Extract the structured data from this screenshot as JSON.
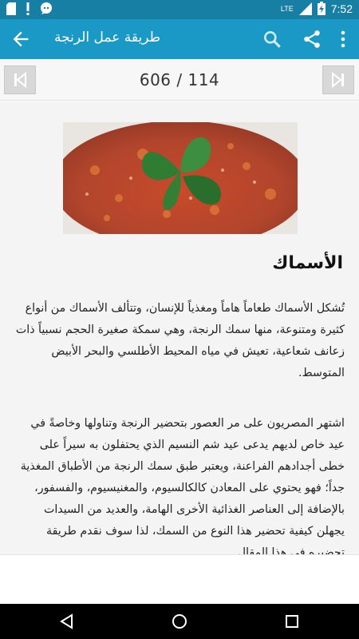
{
  "status_bar": {
    "time": "7:52",
    "network": "LTE",
    "icons": [
      "sim-card-icon",
      "alert-icon",
      "chat-bubble-icon",
      "signal-icon",
      "battery-charging-icon"
    ]
  },
  "app_bar": {
    "title": "طريقة عمل الرنجة",
    "icons": [
      "back-arrow-icon",
      "search-icon",
      "share-icon",
      "more-vert-icon"
    ],
    "color": "#1b99c6"
  },
  "pager": {
    "counter": "606 / 114",
    "prev_icon": "skip-previous-icon",
    "next_icon": "skip-next-icon"
  },
  "article": {
    "heading": "الأسماك",
    "paragraph_1": "تُشكل الأسماك طعاماً هاماً ومغذياً للإنسان، وتتألف الأسماك من أنواع كثيرة ومتنوعة، منها سمك الرنجة، وهي سمكة صغيرة الحجم نسبياً ذات زعانف شعاعية، تعيش في مياه المحيط الأطلسي والبحر الأبيض المتوسط.",
    "paragraph_2": "اشتهر المصريون على مر العصور بتحضير الرنجة وتناولها وخاصةً في عيد خاص لديهم يدعى عيد شم النسيم الذي يحتفلون به سيراً على خطى أجدادهم الفراعنة، ويعتبر طبق سمك الرنجة من الأطباق المغذية جداً؛ فهو يحتوي على المعادن كالكالسيوم، والمغنيسيوم، والفسفور، بالإضافة إلى العناصر الغذائية الأخرى الهامة، والعديد من السيدات يجهلن كيفية تحضير هذا النوع من السمك، لذا سوف نقدم طريقة تحضيره في هذا المقال."
  },
  "nav_bar": {
    "icons": [
      "nav-back-icon",
      "nav-home-icon",
      "nav-recents-icon"
    ]
  }
}
